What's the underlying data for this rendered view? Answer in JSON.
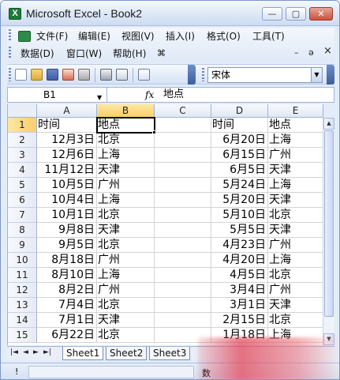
{
  "window": {
    "title": "Microsoft Excel - Book2",
    "app_icon": "X",
    "controls": {
      "minimize": "—",
      "maximize": "▢",
      "close": "✕"
    }
  },
  "menu": {
    "row1": [
      "文件(F)",
      "编辑(E)",
      "视图(V)",
      "插入(I)",
      "格式(O)",
      "工具(T)"
    ],
    "row2": [
      "数据(D)",
      "窗口(W)",
      "帮助(H)"
    ],
    "mdi_controls": {
      "minimize": "–",
      "restore": "ə",
      "close": "×"
    }
  },
  "toolbar": {
    "icons": [
      "new-doc-icon",
      "open-folder-icon",
      "save-icon",
      "permission-icon",
      "print-icon",
      "print-preview-icon",
      "spelling-icon"
    ],
    "font_name": "宋体"
  },
  "formula_bar": {
    "name_box": "B1",
    "fx_label": "fx",
    "formula": "地点"
  },
  "grid": {
    "columns": [
      "A",
      "B",
      "C",
      "D",
      "E"
    ],
    "active_column": "B",
    "active_row": "1",
    "rows": [
      {
        "num": "1",
        "A": "时间",
        "B": "地点",
        "C": "",
        "D": "时间",
        "E": "地点"
      },
      {
        "num": "2",
        "A": "12月3日",
        "B": "北京",
        "C": "",
        "D": "6月20日",
        "E": "上海"
      },
      {
        "num": "3",
        "A": "12月6日",
        "B": "上海",
        "C": "",
        "D": "6月15日",
        "E": "广州"
      },
      {
        "num": "4",
        "A": "11月12日",
        "B": "天津",
        "C": "",
        "D": "6月5日",
        "E": "天津"
      },
      {
        "num": "5",
        "A": "10月5日",
        "B": "广州",
        "C": "",
        "D": "5月24日",
        "E": "上海"
      },
      {
        "num": "6",
        "A": "10月4日",
        "B": "上海",
        "C": "",
        "D": "5月20日",
        "E": "天津"
      },
      {
        "num": "7",
        "A": "10月1日",
        "B": "北京",
        "C": "",
        "D": "5月10日",
        "E": "北京"
      },
      {
        "num": "8",
        "A": "9月8日",
        "B": "天津",
        "C": "",
        "D": "5月5日",
        "E": "天津"
      },
      {
        "num": "9",
        "A": "9月5日",
        "B": "北京",
        "C": "",
        "D": "4月23日",
        "E": "广州"
      },
      {
        "num": "10",
        "A": "8月18日",
        "B": "广州",
        "C": "",
        "D": "4月20日",
        "E": "上海"
      },
      {
        "num": "11",
        "A": "8月10日",
        "B": "上海",
        "C": "",
        "D": "4月5日",
        "E": "北京"
      },
      {
        "num": "12",
        "A": "8月2日",
        "B": "广州",
        "C": "",
        "D": "3月4日",
        "E": "广州"
      },
      {
        "num": "13",
        "A": "7月4日",
        "B": "北京",
        "C": "",
        "D": "3月1日",
        "E": "天津"
      },
      {
        "num": "14",
        "A": "7月1日",
        "B": "天津",
        "C": "",
        "D": "2月15日",
        "E": "北京"
      },
      {
        "num": "15",
        "A": "6月22日",
        "B": "北京",
        "C": "",
        "D": "1月18日",
        "E": "上海"
      }
    ]
  },
  "sheet_tabs": {
    "nav": [
      "|◄",
      "◄",
      "►",
      "►|"
    ],
    "tabs": [
      "Sheet1",
      "Sheet2",
      "Sheet3"
    ],
    "active": "Sheet1"
  },
  "status": {
    "left": "!",
    "partial": "数"
  },
  "colors": {
    "chrome": "#e3ecf9",
    "active_header": "#f9cf6b",
    "excel_green": "#1f7a3a"
  }
}
